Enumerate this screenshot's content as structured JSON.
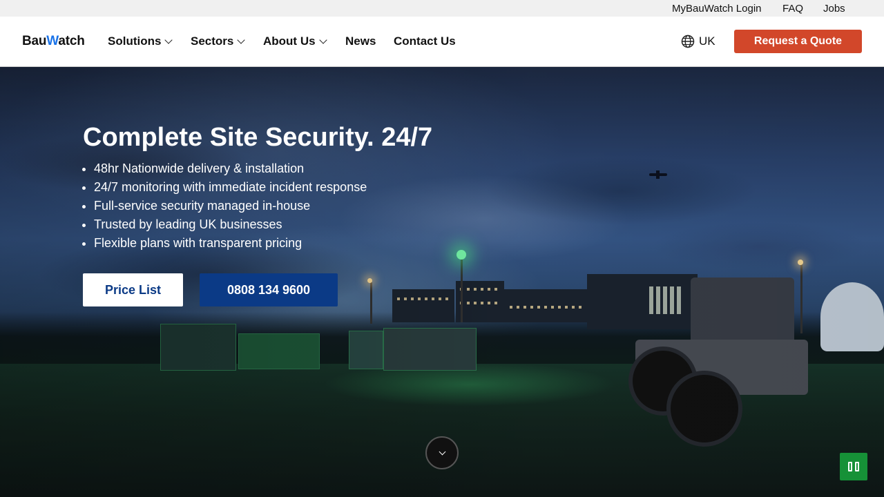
{
  "utility_bar": {
    "links": [
      "MyBauWatch Login",
      "FAQ",
      "Jobs"
    ]
  },
  "header": {
    "logo": {
      "part1": "Bau",
      "part2": "W",
      "part3": "atch"
    },
    "nav": [
      {
        "label": "Solutions",
        "has_dropdown": true
      },
      {
        "label": "Sectors",
        "has_dropdown": true
      },
      {
        "label": "About Us",
        "has_dropdown": true
      },
      {
        "label": "News",
        "has_dropdown": false
      },
      {
        "label": "Contact Us",
        "has_dropdown": false
      }
    ],
    "language": "UK",
    "language_icon": "globe-icon",
    "cta_label": "Request a Quote"
  },
  "hero": {
    "title": "Complete Site Security. 24/7",
    "bullets": [
      "48hr Nationwide delivery & installation",
      "24/7 monitoring with immediate incident response",
      "Full-service security managed in-house",
      "Trusted by leading UK businesses",
      "Flexible plans with transparent pricing"
    ],
    "price_button": "Price List",
    "phone_button": "0808 134 9600",
    "scroll_icon": "chevron-down-icon",
    "pause_icon": "pause-icon"
  },
  "colors": {
    "accent_orange": "#d2472a",
    "brand_blue": "#0b3a86",
    "pause_green": "#169137"
  }
}
